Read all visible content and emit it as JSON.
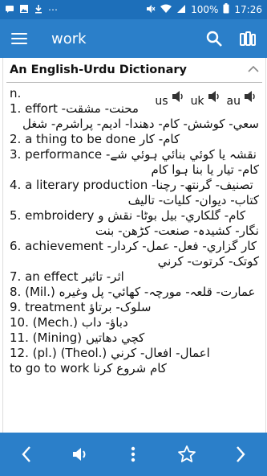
{
  "status": {
    "battery": "100%",
    "time": "17:26"
  },
  "appbar": {
    "title": "work"
  },
  "dictionary": {
    "name": "An English-Urdu Dictionary",
    "pos": "n.",
    "audio": [
      "us",
      "uk",
      "au"
    ]
  },
  "senses": [
    {
      "num": "1.",
      "en": "effort",
      "ur": [
        "محنت- مشقت-",
        "سعي- كوشش- كام- دهندا- اديم- پراشرم- شغل"
      ]
    },
    {
      "num": "2.",
      "en": "a thing to be done",
      "ur": [
        "كام- كار"
      ]
    },
    {
      "num": "3.",
      "en": "performance",
      "ur": [
        "نقشہ يا كوئي بنائي ہوئي شے-",
        "كام- تيار يا بنا ہوا كام"
      ]
    },
    {
      "num": "4.",
      "en": "a literary production",
      "ur": [
        "تصنيف- گرنتھ- رچنا-",
        "كتاب- ديوان- كليات- تاليف"
      ]
    },
    {
      "num": "5.",
      "en": "embroidery",
      "ur": [
        "كام- گلكاري- بيل بوٹا- نقش و",
        "نگار- كشيدہ- صنعت- كڑھن- بنت"
      ]
    },
    {
      "num": "6.",
      "en": "achievement",
      "ur": [
        "كار گزاري- فعل- عمل- كردار-",
        "كوتک- كرتوت- كرني"
      ]
    },
    {
      "num": "7.",
      "en": "an effect",
      "ur": [
        "اثر- تاثير"
      ]
    },
    {
      "num": "8.",
      "en": "(Mil.)",
      "ur": [
        "عمارت- قلعہ- مورچہ- كهائي- پل وغيره"
      ]
    },
    {
      "num": "9.",
      "en": "treatment",
      "ur": [
        "سلوک- برتاؤ"
      ]
    },
    {
      "num": "10.",
      "en": "(Mech.)",
      "ur": [
        "دباؤ- داب"
      ]
    },
    {
      "num": "11.",
      "en": "(Mining)",
      "ur": [
        "كچي دهاتيں"
      ]
    },
    {
      "num": "12.",
      "en": "(pl.) (Theol.)",
      "ur": [
        "اعمال- افعال- كرني"
      ]
    },
    {
      "num": "",
      "en": "to go to work",
      "ur": [
        "كام شروع كرنا"
      ]
    }
  ]
}
